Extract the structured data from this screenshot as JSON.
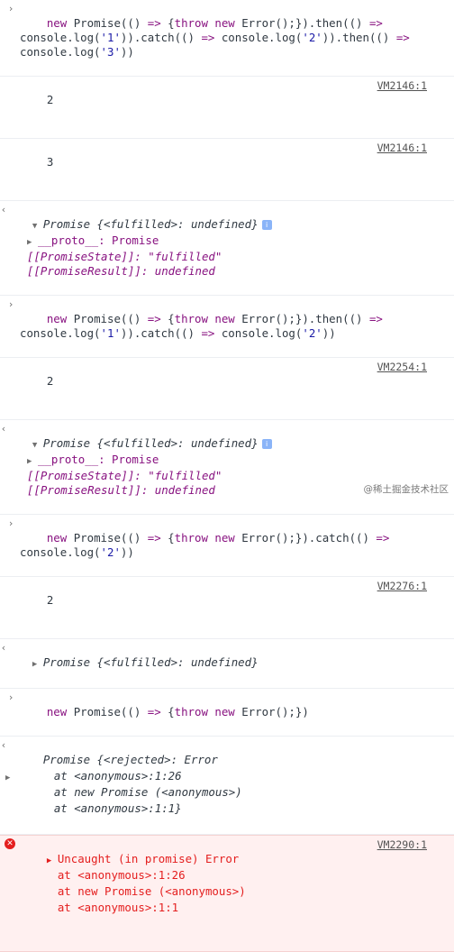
{
  "entries": [
    {
      "type": "input",
      "lines": [
        "new Promise(() => {throw new Error();}).then(() =>",
        "console.log('1')).catch(() => console.log('2')).then(() =>",
        "console.log('3'))"
      ]
    },
    {
      "type": "log",
      "text": "2",
      "source": "VM2146:1"
    },
    {
      "type": "log",
      "text": "3",
      "source": "VM2146:1"
    },
    {
      "type": "result-expanded",
      "summary": "Promise {<fulfilled>: undefined}",
      "proto": "__proto__: Promise",
      "state": "[[PromiseState]]: \"fulfilled\"",
      "result": "[[PromiseResult]]: undefined"
    },
    {
      "type": "input",
      "lines": [
        "new Promise(() => {throw new Error();}).then(() =>",
        "console.log('1')).catch(() => console.log('2'))"
      ]
    },
    {
      "type": "log",
      "text": "2",
      "source": "VM2254:1"
    },
    {
      "type": "result-expanded",
      "summary": "Promise {<fulfilled>: undefined}",
      "proto": "__proto__: Promise",
      "state": "[[PromiseState]]: \"fulfilled\"",
      "result": "[[PromiseResult]]: undefined"
    },
    {
      "type": "input",
      "lines": [
        "new Promise(() => {throw new Error();}).catch(() =>",
        "console.log('2'))"
      ]
    },
    {
      "type": "log",
      "text": "2",
      "source": "VM2276:1"
    },
    {
      "type": "result",
      "summary": "Promise {<fulfilled>: undefined}"
    },
    {
      "type": "input",
      "lines": [
        "new Promise(() => {throw new Error();})"
      ]
    },
    {
      "type": "result-rejected",
      "lines": [
        "Promise {<rejected>: Error",
        "    at <anonymous>:1:26",
        "    at new Promise (<anonymous>)",
        "    at <anonymous>:1:1}"
      ]
    },
    {
      "type": "error",
      "lines": [
        "Uncaught (in promise) Error",
        "    at <anonymous>:1:26",
        "    at new Promise (<anonymous>)",
        "    at <anonymous>:1:1"
      ],
      "source": "VM2290:1"
    }
  ],
  "watermark": "@稀土掘金技术社区"
}
